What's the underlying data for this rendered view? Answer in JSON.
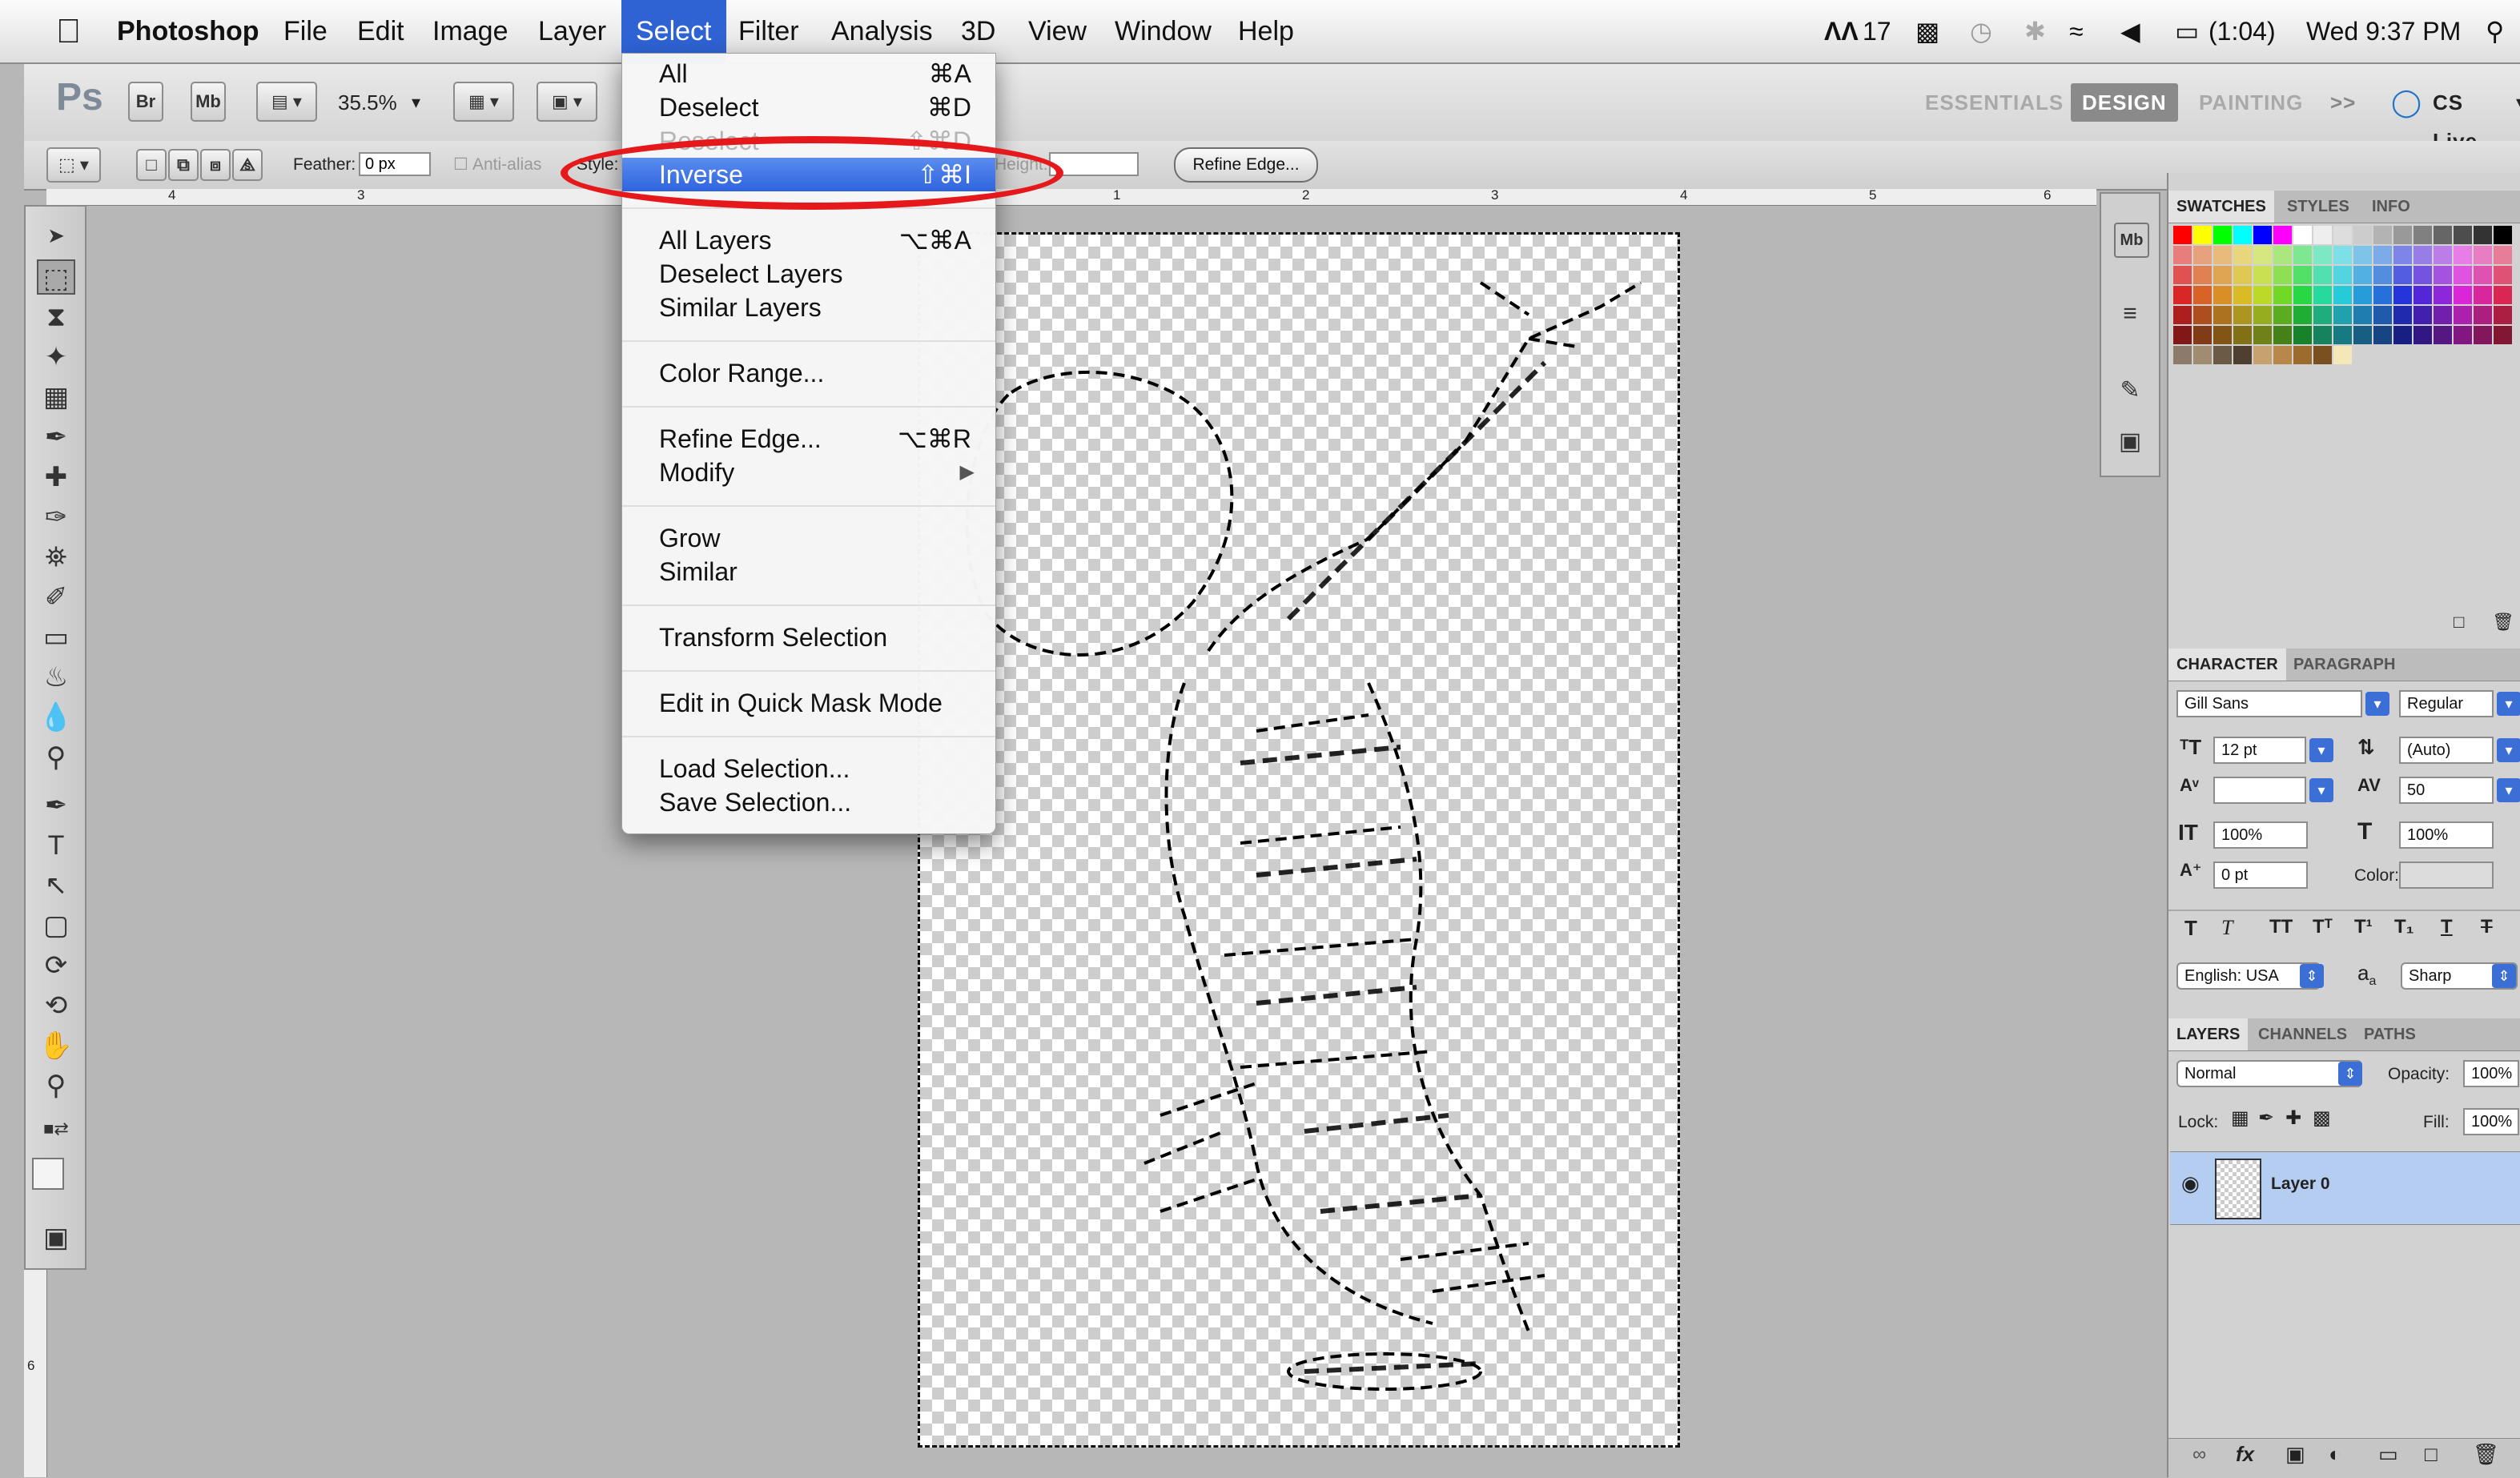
{
  "menubar": {
    "app_name": "Photoshop",
    "menus": [
      "File",
      "Edit",
      "Image",
      "Layer",
      "Select",
      "Filter",
      "Analysis",
      "3D",
      "View",
      "Window",
      "Help"
    ],
    "status": {
      "adobe_count": "17",
      "battery": "(1:04)",
      "clock": "Wed 9:37 PM"
    }
  },
  "appbar": {
    "ps_logo": "Ps",
    "br_label": "Br",
    "mb_label": "Mb",
    "zoom": "35.5%",
    "workspaces": [
      "ESSENTIALS",
      "DESIGN",
      "PAINTING"
    ],
    "overflow": ">>",
    "cs_live": "CS Live"
  },
  "options": {
    "feather_label": "Feather:",
    "feather_value": "0 px",
    "anti_alias": "Anti-alias",
    "style_label": "Style:",
    "height_label": "Height:",
    "refine_edge": "Refine Edge..."
  },
  "ruler": {
    "top_marks": [
      "4",
      "3",
      "1",
      "2",
      "3",
      "4",
      "5",
      "6"
    ],
    "left_mark": "6"
  },
  "select_menu": {
    "groups": [
      [
        {
          "label": "All",
          "shortcut": "⌘A"
        },
        {
          "label": "Deselect",
          "shortcut": "⌘D"
        },
        {
          "label": "Reselect",
          "shortcut": "⇧⌘D",
          "disabled": true
        },
        {
          "label": "Inverse",
          "shortcut": "⇧⌘I",
          "highlighted": true
        }
      ],
      [
        {
          "label": "All Layers",
          "shortcut": "⌥⌘A"
        },
        {
          "label": "Deselect Layers",
          "shortcut": ""
        },
        {
          "label": "Similar Layers",
          "shortcut": ""
        }
      ],
      [
        {
          "label": "Color Range...",
          "shortcut": ""
        }
      ],
      [
        {
          "label": "Refine Edge...",
          "shortcut": "⌥⌘R"
        },
        {
          "label": "Modify",
          "shortcut": "",
          "submenu": true
        }
      ],
      [
        {
          "label": "Grow",
          "shortcut": ""
        },
        {
          "label": "Similar",
          "shortcut": ""
        }
      ],
      [
        {
          "label": "Transform Selection",
          "shortcut": ""
        }
      ],
      [
        {
          "label": "Edit in Quick Mask Mode",
          "shortcut": ""
        }
      ],
      [
        {
          "label": "Load Selection...",
          "shortcut": ""
        },
        {
          "label": "Save Selection...",
          "shortcut": ""
        }
      ]
    ]
  },
  "panels": {
    "swatch_tabs": [
      "SWATCHES",
      "STYLES",
      "INFO"
    ],
    "char_tabs": [
      "CHARACTER",
      "PARAGRAPH"
    ],
    "font_family": "Gill Sans",
    "font_style": "Regular",
    "font_size": "12 pt",
    "leading": "(Auto)",
    "tracking": "50",
    "vert_scale": "100%",
    "horiz_scale": "100%",
    "baseline_shift": "0 pt",
    "color_label": "Color:",
    "language": "English: USA",
    "aa_label": "a",
    "antialias": "Sharp",
    "layer_tabs": [
      "LAYERS",
      "CHANNELS",
      "PATHS"
    ],
    "blend_mode": "Normal",
    "opacity_label": "Opacity:",
    "opacity": "100%",
    "lock_label": "Lock:",
    "fill_label": "Fill:",
    "fill": "100%",
    "layer_name": "Layer 0"
  },
  "colors": {
    "menu_highlight": "#2e64de",
    "annotation_ring": "#e5191c",
    "layer_selected": "#b5cdf0"
  }
}
